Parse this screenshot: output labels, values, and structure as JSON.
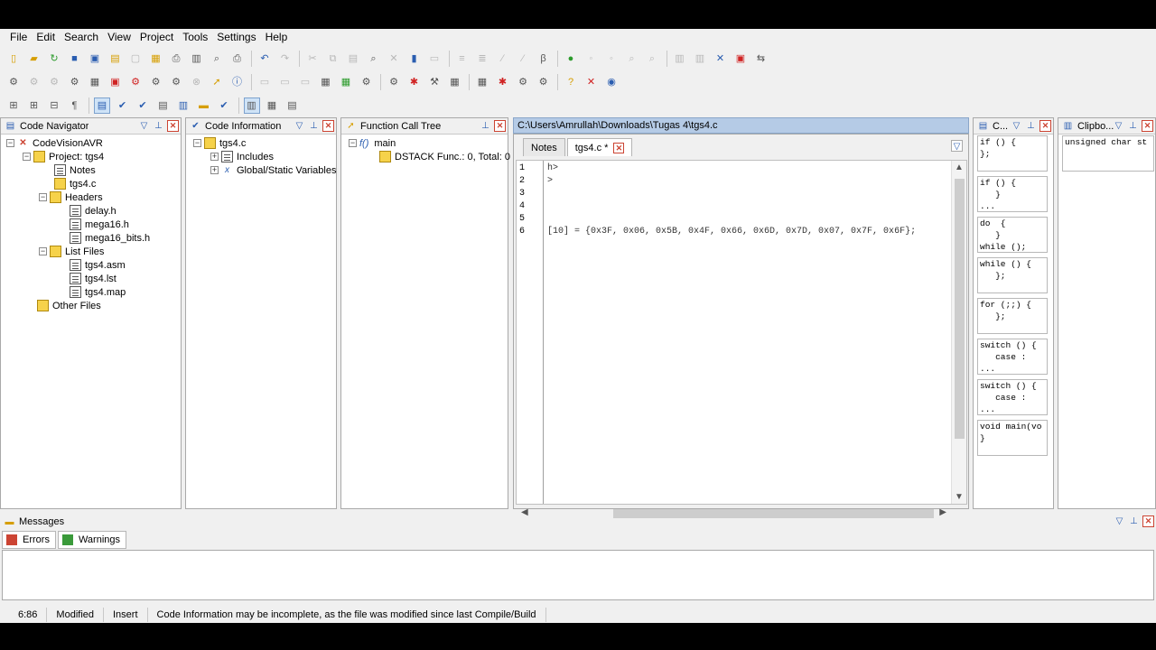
{
  "menu": [
    "File",
    "Edit",
    "Search",
    "View",
    "Project",
    "Tools",
    "Settings",
    "Help"
  ],
  "toolbar_icons": {
    "row1": [
      "new-file-icon",
      "open-icon",
      "reload-icon",
      "save-icon",
      "save-all-icon",
      "close-icon",
      "print-icon",
      "undo-icon",
      "redo-icon",
      "cut-icon",
      "copy-icon",
      "paste-icon",
      "find-icon",
      "bookmark-icon"
    ],
    "row2": [
      "compile-icon",
      "build-icon",
      "program-chip-icon",
      "info-icon",
      "debug-icon",
      "settings-icon",
      "help-icon",
      "web-icon"
    ],
    "row3": [
      "tree-expand-icon",
      "paragraph-icon",
      "code-nav-icon",
      "layout-icon"
    ]
  },
  "code_navigator": {
    "title": "Code Navigator",
    "root": "CodeVisionAVR",
    "project": "Project: tgs4",
    "notes": "Notes",
    "source": "tgs4.c",
    "headers_label": "Headers",
    "headers": [
      "delay.h",
      "mega16.h",
      "mega16_bits.h"
    ],
    "list_files_label": "List Files",
    "list_files": [
      "tgs4.asm",
      "tgs4.lst",
      "tgs4.map"
    ],
    "other_files": "Other Files"
  },
  "code_information": {
    "title": "Code Information",
    "file": "tgs4.c",
    "includes": "Includes",
    "globals": "Global/Static Variables"
  },
  "function_call_tree": {
    "title": "Function Call Tree",
    "main": "main",
    "main_prefix": "f()",
    "dstack": "DSTACK Func.: 0, Total: 0"
  },
  "editor": {
    "path": "C:\\Users\\Amrullah\\Downloads\\Tugas 4\\tgs4.c",
    "tabs": [
      "Notes",
      "tgs4.c *"
    ],
    "line_numbers": [
      "1",
      "2",
      "3",
      "4",
      "5",
      "6"
    ],
    "lines": [
      "h>",
      ">",
      "",
      "",
      "",
      "[10] = {0x3F, 0x06, 0x5B, 0x4F, 0x66, 0x6D, 0x7D, 0x07, 0x7F, 0x6F};"
    ]
  },
  "snippets_panel": {
    "title": "C...",
    "items": [
      "if () {\n};",
      "if () {\n   }\n...",
      "do  {\n   }\nwhile ();",
      "while () {\n   };",
      "for (;;) {\n   };",
      "switch () {\n   case :\n...",
      "switch () {\n   case :\n...",
      "void main(vo\n}"
    ]
  },
  "clipboard_panel": {
    "title": "Clipbo...",
    "item": "unsigned char st"
  },
  "messages": {
    "title": "Messages",
    "tabs": [
      "Errors",
      "Warnings"
    ]
  },
  "status": {
    "position": "6:86",
    "modified": "Modified",
    "mode": "Insert",
    "message": "Code Information may be incomplete, as the file was modified since last Compile/Build"
  }
}
